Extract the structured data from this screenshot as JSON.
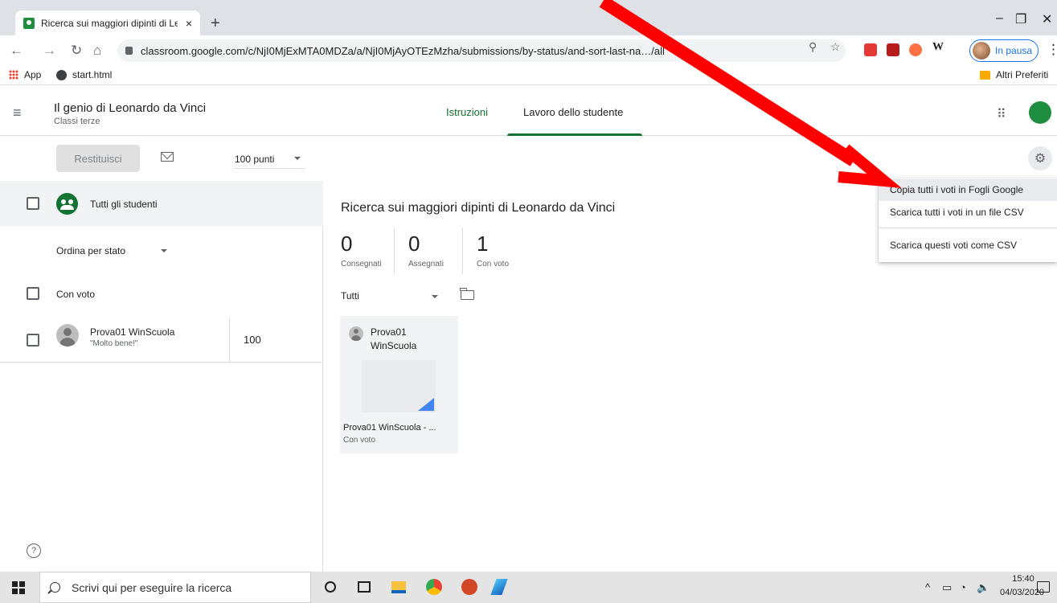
{
  "browser": {
    "tab_title": "Ricerca sui maggiori dipinti di Le",
    "tab_close": "×",
    "new_tab": "+",
    "url": "classroom.google.com/c/NjI0MjExMTA0MDZa/a/NjI0MjAyOTEzMzha/submissions/by-status/and-sort-last-na…/all",
    "profile_label": "In pausa",
    "bookmarks": [
      {
        "label": "App",
        "icon": "apps-grid-icon"
      },
      {
        "label": "start.html",
        "icon": "globe-icon"
      }
    ],
    "other_bookmarks": "Altri Preferiti"
  },
  "classroom": {
    "course_title": "Il genio di Leonardo da Vinci",
    "course_subtitle": "Classi terze",
    "tabs": [
      {
        "label": "Istruzioni",
        "active": false
      },
      {
        "label": "Lavoro dello studente",
        "active": true
      }
    ]
  },
  "actions": {
    "return_label": "Restituisci",
    "points_label": "100 punti"
  },
  "left_panel": {
    "all_students_label": "Tutti gli studenti",
    "sort_label": "Ordina per stato",
    "group_label": "Con voto",
    "students": [
      {
        "name": "Prova01 WinScuola",
        "comment": "\"Molto bene!\"",
        "score": "100"
      }
    ]
  },
  "assignment": {
    "title": "Ricerca sui maggiori dipinti di Leonardo da Vinci",
    "stats": [
      {
        "value": "0",
        "label": "Consegnati"
      },
      {
        "value": "0",
        "label": "Assegnati"
      },
      {
        "value": "1",
        "label": "Con voto"
      }
    ],
    "filter_label": "Tutti",
    "card": {
      "student_line1": "Prova01",
      "student_line2": "WinScuola",
      "file_name": "Prova01 WinScuola - ...",
      "status": "Con voto"
    }
  },
  "menu": {
    "items": [
      {
        "label": "Copia tutti i voti in Fogli Google",
        "highlighted": true
      },
      {
        "label": "Scarica tutti i voti in un file CSV",
        "highlighted": false
      },
      {
        "label": "Scarica questi voti come CSV",
        "highlighted": false
      }
    ]
  },
  "taskbar": {
    "search_placeholder": "Scrivi qui per eseguire la ricerca",
    "time": "15:40",
    "date": "04/03/2020"
  },
  "colors": {
    "accent": "#137333",
    "annotation_arrow": "#ff0000",
    "link_blue": "#1a73e8"
  }
}
